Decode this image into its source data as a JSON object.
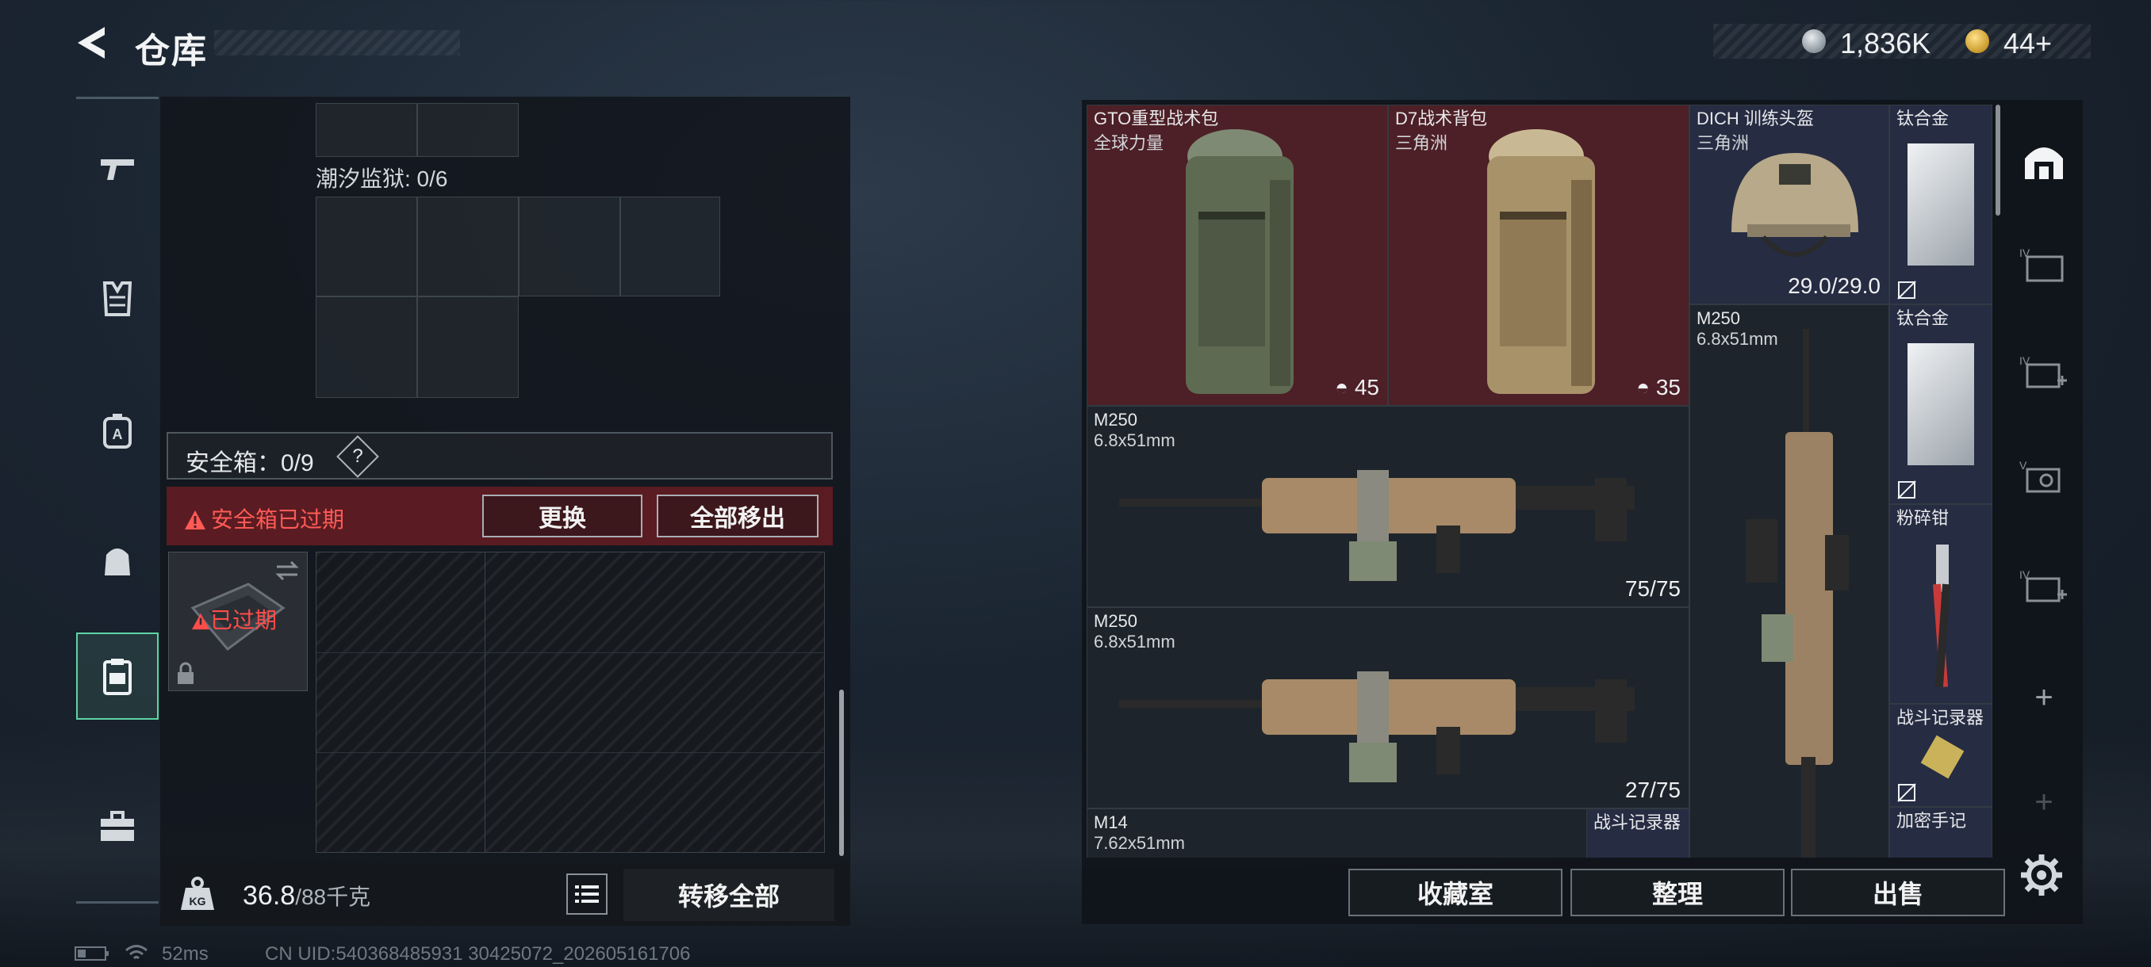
{
  "header": {
    "title": "仓库"
  },
  "currency": {
    "silver": "1,836K",
    "gold": "44+"
  },
  "left": {
    "tide_label": "潮汐监狱: 0/6",
    "safebox_label": "安全箱：0/9",
    "safebox_help": "?",
    "expired_message": "安全箱已过期",
    "replace_button": "更换",
    "remove_all_button": "全部移出",
    "expired_tag": "已过期",
    "weight": "36.8",
    "weight_capacity": "/88千克",
    "transfer_all_button": "转移全部"
  },
  "status_bar": {
    "ping": "52ms",
    "uid": "CN UID:540368485931 30425072_202605161706"
  },
  "stash": {
    "items": [
      {
        "name": "GTO重型战术包",
        "sub": "全球力量",
        "count": "45"
      },
      {
        "name": "D7战术背包",
        "sub": "三角洲",
        "count": "35"
      },
      {
        "name": "DICH 训练头盔",
        "sub": "三角洲",
        "count": "29.0/29.0"
      },
      {
        "name": "钛合金"
      },
      {
        "name": "M250",
        "sub": "6.8x51mm"
      },
      {
        "name": "钛合金"
      },
      {
        "name": "M250",
        "sub": "6.8x51mm",
        "count": "75/75"
      },
      {
        "name": "粉碎钳"
      },
      {
        "name": "M250",
        "sub": "6.8x51mm",
        "count": "27/75"
      },
      {
        "name": "战斗记录器"
      },
      {
        "name": "M14",
        "sub": "7.62x51mm"
      },
      {
        "name": "战斗记录器"
      },
      {
        "name": "加密手记"
      }
    ]
  },
  "buttons": {
    "collection": "收藏室",
    "sort": "整理",
    "sell": "出售"
  },
  "right_nav": {
    "add": "+"
  },
  "colors": {
    "accent": "#5fd3a4",
    "danger": "#ff5a56",
    "item_red": "#4d1f26"
  }
}
